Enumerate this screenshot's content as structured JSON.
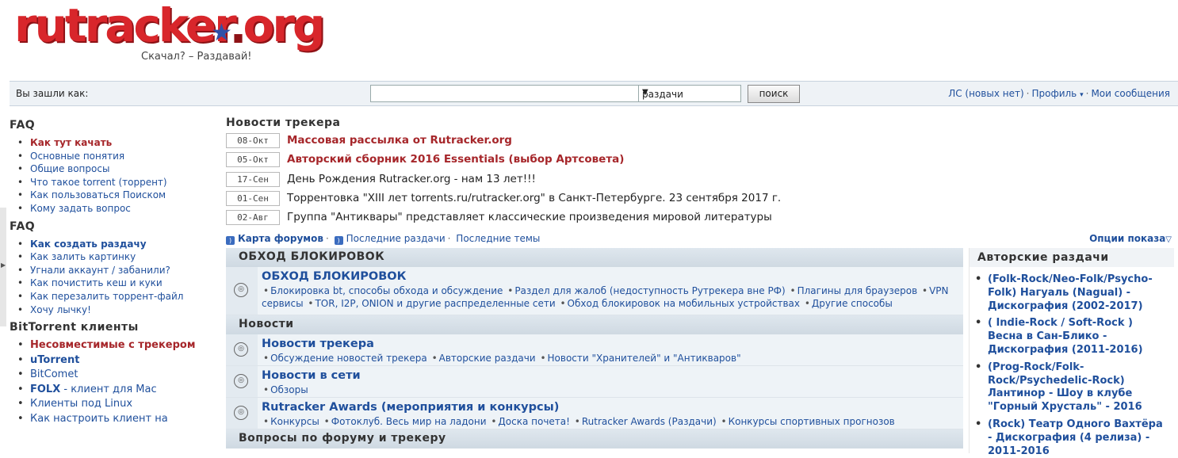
{
  "logo": {
    "text": "rutracker",
    "text2": "org",
    "slogan": "Скачал? – Раздавай!"
  },
  "topbar": {
    "logged_label": "Вы зашли как:",
    "search_value": "",
    "search_placeholder": "",
    "select_value": "раздачи",
    "search_button": "поиск",
    "pm_link": "ЛС (новых нет)",
    "profile_link": "Профиль",
    "messages_link": "Мои сообщения"
  },
  "sidebar": {
    "faq1_title": "FAQ",
    "faq1_items": [
      "Как тут качать",
      "Основные понятия",
      "Общие вопросы",
      "Что такое torrent (торрент)",
      "Как пользоваться Поиском",
      "Кому задать вопрос"
    ],
    "faq2_title": "FAQ",
    "faq2_items": [
      "Как создать раздачу",
      "Как залить картинку",
      "Угнали аккаунт / забанили?",
      "Как почистить кеш и куки",
      "Как перезалить торрент-файл",
      "Хочу лычку!"
    ],
    "clients_title": "BitTorrent клиенты",
    "clients_items": [
      "Несовместимые с трекером",
      "uTorrent",
      "BitComet",
      "FOLX",
      " - клиент для Mac",
      "Клиенты под Linux",
      "Как настроить клиент на"
    ]
  },
  "news": {
    "title": "Новости трекера",
    "items": [
      {
        "date": "08-Окт",
        "text": "Массовая рассылка от Rutracker.org"
      },
      {
        "date": "05-Окт",
        "text": "Авторский сборник 2016 Essentials (выбор Артсовета)"
      },
      {
        "date": "17-Сен",
        "text": "День Рождения Rutracker.org - нам 13 лет!!!"
      },
      {
        "date": "01-Сен",
        "text": "Торрентовка \"XIII лет torrents.ru/rutracker.org\" в Санкт-Петербурге. 23 сентября 2017 г."
      },
      {
        "date": "02-Авг",
        "text": "Группа \"Антиквары\" представляет классические произведения мировой литературы"
      }
    ]
  },
  "maprow": {
    "forum_map": "Карта форумов",
    "latest_releases": "Последние раздачи",
    "latest_topics": "Последние темы",
    "options": "Опции показа"
  },
  "forum": {
    "cat1": "ОБХОД БЛОКИРОВОК",
    "f1_name": "ОБХОД БЛОКИРОВОК",
    "f1_subs": [
      "Блокировка bt, способы обхода и обсуждение",
      "Раздел для жалоб (недоступность Рутрекера вне РФ)",
      "Плагины для браузеров",
      "VPN сервисы",
      "TOR, I2P, ONION и другие распределенные сети",
      "Обход блокировок на мобильных устройствах",
      "Другие способы"
    ],
    "cat2": "Новости",
    "f2_name": "Новости трекера",
    "f2_subs": [
      "Обсуждение новостей трекера",
      "Авторские раздачи",
      "Новости \"Хранителей\" и \"Антикваров\""
    ],
    "f3_name": "Новости в сети",
    "f3_subs": [
      "Обзоры"
    ],
    "f4_name": "Rutracker Awards (мероприятия и конкурсы)",
    "f4_subs": [
      "Конкурсы",
      "Фотоклуб. Весь мир на ладони",
      "Доска почета!",
      "Rutracker Awards (Раздачи)",
      "Конкурсы спортивных прогнозов"
    ],
    "cat3": "Вопросы по форуму и трекеру"
  },
  "right_sidebar": {
    "title": "Авторские раздачи",
    "items": [
      "(Folk-Rock/Neo-Folk/Psycho-Folk) Нагуаль (Nagual) - Дискография (2002-2017)",
      "( Indie-Rock / Soft-Rock ) Весна в Сан-Блико - Дискография (2011-2016)",
      "(Prog-Rock/Folk-Rock/Psychedelic-Rock) Лантинор - Шоу в клубе \"Горный Хрусталь\" - 2016",
      "(Rock) Театр Одного Вахтёра - Дискография (4 релиза) - 2011-2016"
    ]
  },
  "colors": {
    "accent_red": "#a6262a",
    "link_blue": "#1f4f9c",
    "logo_red": "#d8262b"
  }
}
